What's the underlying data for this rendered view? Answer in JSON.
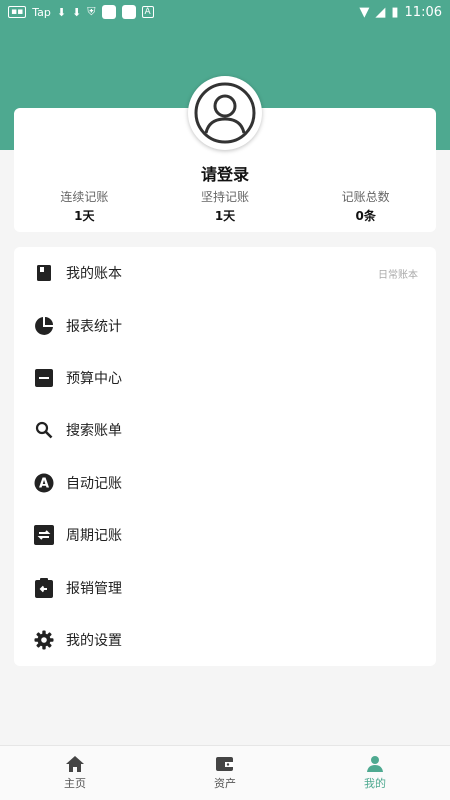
{
  "status_bar": {
    "left_items": [
      "Tap"
    ],
    "time": "11:06"
  },
  "profile": {
    "login_prompt": "请登录",
    "stats": [
      {
        "label": "连续记账",
        "value": "1天"
      },
      {
        "label": "坚持记账",
        "value": "1天"
      },
      {
        "label": "记账总数",
        "value": "0条"
      }
    ]
  },
  "menu": {
    "items": [
      {
        "label": "我的账本",
        "note": "日常账本",
        "icon": "book-icon"
      },
      {
        "label": "报表统计",
        "icon": "pie-chart-icon"
      },
      {
        "label": "预算中心",
        "icon": "budget-icon"
      },
      {
        "label": "搜索账单",
        "icon": "search-icon"
      },
      {
        "label": "自动记账",
        "icon": "auto-icon"
      },
      {
        "label": "周期记账",
        "icon": "repeat-icon"
      },
      {
        "label": "报销管理",
        "icon": "clipboard-icon"
      },
      {
        "label": "我的设置",
        "icon": "gear-icon"
      }
    ]
  },
  "bottom_nav": {
    "tabs": [
      {
        "label": "主页",
        "icon": "home-icon"
      },
      {
        "label": "资产",
        "icon": "wallet-icon"
      },
      {
        "label": "我的",
        "icon": "user-icon"
      }
    ],
    "active_index": 2
  },
  "colors": {
    "accent": "#4ea990",
    "background": "#f5f5f5"
  }
}
